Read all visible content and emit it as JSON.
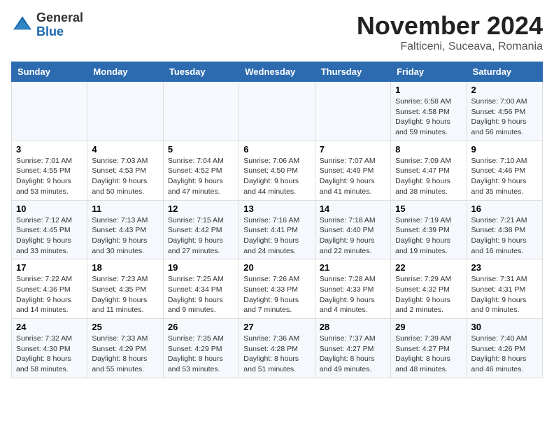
{
  "logo": {
    "general": "General",
    "blue": "Blue"
  },
  "header": {
    "month": "November 2024",
    "location": "Falticeni, Suceava, Romania"
  },
  "weekdays": [
    "Sunday",
    "Monday",
    "Tuesday",
    "Wednesday",
    "Thursday",
    "Friday",
    "Saturday"
  ],
  "weeks": [
    [
      {
        "day": "",
        "info": ""
      },
      {
        "day": "",
        "info": ""
      },
      {
        "day": "",
        "info": ""
      },
      {
        "day": "",
        "info": ""
      },
      {
        "day": "",
        "info": ""
      },
      {
        "day": "1",
        "info": "Sunrise: 6:58 AM\nSunset: 4:58 PM\nDaylight: 9 hours and 59 minutes."
      },
      {
        "day": "2",
        "info": "Sunrise: 7:00 AM\nSunset: 4:56 PM\nDaylight: 9 hours and 56 minutes."
      }
    ],
    [
      {
        "day": "3",
        "info": "Sunrise: 7:01 AM\nSunset: 4:55 PM\nDaylight: 9 hours and 53 minutes."
      },
      {
        "day": "4",
        "info": "Sunrise: 7:03 AM\nSunset: 4:53 PM\nDaylight: 9 hours and 50 minutes."
      },
      {
        "day": "5",
        "info": "Sunrise: 7:04 AM\nSunset: 4:52 PM\nDaylight: 9 hours and 47 minutes."
      },
      {
        "day": "6",
        "info": "Sunrise: 7:06 AM\nSunset: 4:50 PM\nDaylight: 9 hours and 44 minutes."
      },
      {
        "day": "7",
        "info": "Sunrise: 7:07 AM\nSunset: 4:49 PM\nDaylight: 9 hours and 41 minutes."
      },
      {
        "day": "8",
        "info": "Sunrise: 7:09 AM\nSunset: 4:47 PM\nDaylight: 9 hours and 38 minutes."
      },
      {
        "day": "9",
        "info": "Sunrise: 7:10 AM\nSunset: 4:46 PM\nDaylight: 9 hours and 35 minutes."
      }
    ],
    [
      {
        "day": "10",
        "info": "Sunrise: 7:12 AM\nSunset: 4:45 PM\nDaylight: 9 hours and 33 minutes."
      },
      {
        "day": "11",
        "info": "Sunrise: 7:13 AM\nSunset: 4:43 PM\nDaylight: 9 hours and 30 minutes."
      },
      {
        "day": "12",
        "info": "Sunrise: 7:15 AM\nSunset: 4:42 PM\nDaylight: 9 hours and 27 minutes."
      },
      {
        "day": "13",
        "info": "Sunrise: 7:16 AM\nSunset: 4:41 PM\nDaylight: 9 hours and 24 minutes."
      },
      {
        "day": "14",
        "info": "Sunrise: 7:18 AM\nSunset: 4:40 PM\nDaylight: 9 hours and 22 minutes."
      },
      {
        "day": "15",
        "info": "Sunrise: 7:19 AM\nSunset: 4:39 PM\nDaylight: 9 hours and 19 minutes."
      },
      {
        "day": "16",
        "info": "Sunrise: 7:21 AM\nSunset: 4:38 PM\nDaylight: 9 hours and 16 minutes."
      }
    ],
    [
      {
        "day": "17",
        "info": "Sunrise: 7:22 AM\nSunset: 4:36 PM\nDaylight: 9 hours and 14 minutes."
      },
      {
        "day": "18",
        "info": "Sunrise: 7:23 AM\nSunset: 4:35 PM\nDaylight: 9 hours and 11 minutes."
      },
      {
        "day": "19",
        "info": "Sunrise: 7:25 AM\nSunset: 4:34 PM\nDaylight: 9 hours and 9 minutes."
      },
      {
        "day": "20",
        "info": "Sunrise: 7:26 AM\nSunset: 4:33 PM\nDaylight: 9 hours and 7 minutes."
      },
      {
        "day": "21",
        "info": "Sunrise: 7:28 AM\nSunset: 4:33 PM\nDaylight: 9 hours and 4 minutes."
      },
      {
        "day": "22",
        "info": "Sunrise: 7:29 AM\nSunset: 4:32 PM\nDaylight: 9 hours and 2 minutes."
      },
      {
        "day": "23",
        "info": "Sunrise: 7:31 AM\nSunset: 4:31 PM\nDaylight: 9 hours and 0 minutes."
      }
    ],
    [
      {
        "day": "24",
        "info": "Sunrise: 7:32 AM\nSunset: 4:30 PM\nDaylight: 8 hours and 58 minutes."
      },
      {
        "day": "25",
        "info": "Sunrise: 7:33 AM\nSunset: 4:29 PM\nDaylight: 8 hours and 55 minutes."
      },
      {
        "day": "26",
        "info": "Sunrise: 7:35 AM\nSunset: 4:29 PM\nDaylight: 8 hours and 53 minutes."
      },
      {
        "day": "27",
        "info": "Sunrise: 7:36 AM\nSunset: 4:28 PM\nDaylight: 8 hours and 51 minutes."
      },
      {
        "day": "28",
        "info": "Sunrise: 7:37 AM\nSunset: 4:27 PM\nDaylight: 8 hours and 49 minutes."
      },
      {
        "day": "29",
        "info": "Sunrise: 7:39 AM\nSunset: 4:27 PM\nDaylight: 8 hours and 48 minutes."
      },
      {
        "day": "30",
        "info": "Sunrise: 7:40 AM\nSunset: 4:26 PM\nDaylight: 8 hours and 46 minutes."
      }
    ]
  ]
}
